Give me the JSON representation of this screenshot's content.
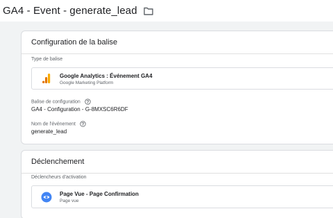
{
  "header": {
    "title": "GA4 - Event - generate_lead",
    "folder_icon": "folder-icon"
  },
  "config_section": {
    "heading": "Configuration de la balise",
    "tag_type_label": "Type de balise",
    "tag_type": {
      "icon": "google-analytics-icon",
      "name": "Google Analytics : Événement GA4",
      "platform": "Google Marketing Platform"
    },
    "config_tag_label": "Balise de configuration",
    "config_tag_value": "GA4 - Configuration - G-8MXSC6R6DF",
    "event_name_label": "Nom de l'événement",
    "event_name_value": "generate_lead"
  },
  "trigger_section": {
    "heading": "Déclenchement",
    "triggers_label": "Déclencheurs d'activation",
    "trigger": {
      "icon": "eye-icon",
      "name": "Page Vue - Page Confirmation",
      "type": "Page vue"
    }
  },
  "colors": {
    "page_background": "#f1f3f4",
    "analytics_orange": "#f9ab00",
    "analytics_dark_orange": "#e37400",
    "trigger_blue": "#4285f4"
  }
}
